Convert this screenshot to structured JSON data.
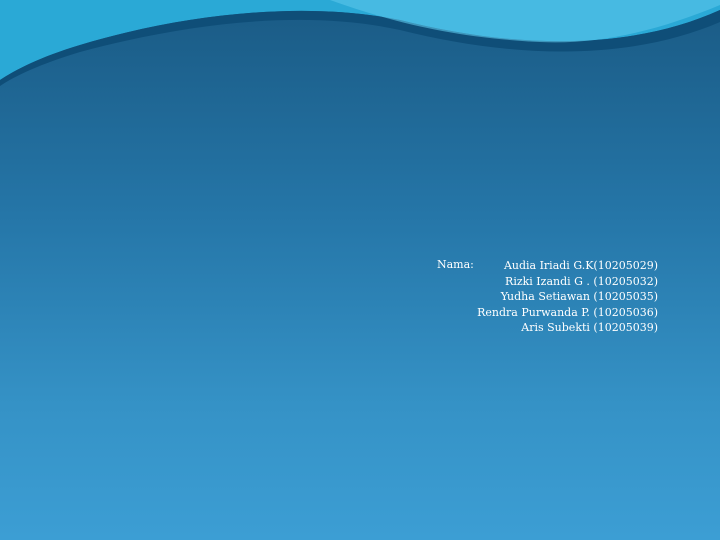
{
  "slide": {
    "label": "Nama:",
    "members": [
      "Audia Iriadi G.K(10205029)",
      "Rizki Izandi G . (10205032)",
      "Yudha Setiawan (10205035)",
      "Rendra Purwanda P. (10205036)",
      "Aris Subekti (10205039)"
    ]
  },
  "colors": {
    "background_top": "#1a5a84",
    "background_bottom": "#3c9ed4",
    "wave_light": "#2aa9d6",
    "wave_dark": "#0f4e78",
    "text": "#ffffff"
  }
}
